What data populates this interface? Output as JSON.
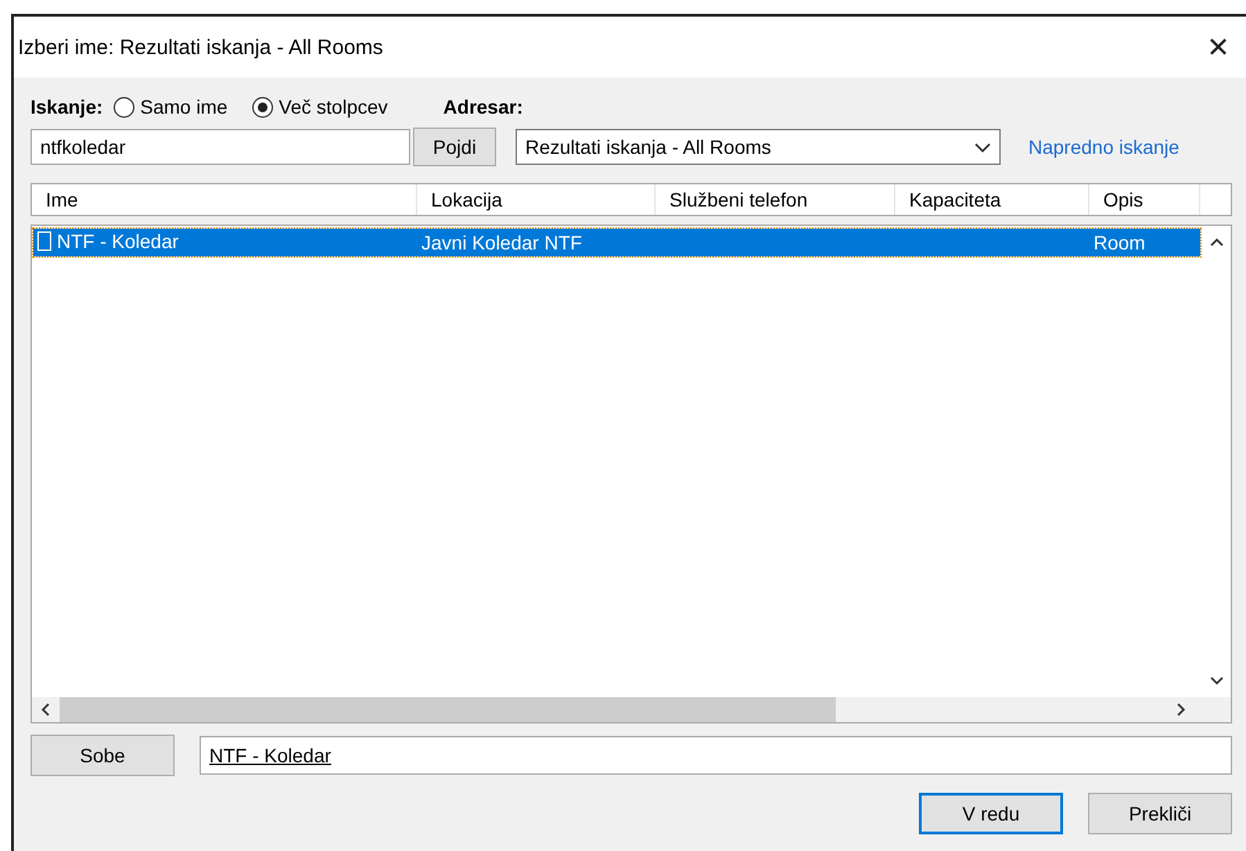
{
  "window": {
    "title": "Izberi ime: Rezultati iskanja - All Rooms",
    "close": "✕"
  },
  "search": {
    "label": "Iskanje:",
    "options": [
      {
        "label": "Samo ime",
        "selected": false
      },
      {
        "label": "Več stolpcev",
        "selected": true
      }
    ],
    "value": "ntfkoledar",
    "go_button": "Pojdi"
  },
  "address_book": {
    "label": "Adresar:",
    "value": "Rezultati iskanja - All Rooms",
    "advanced_link": "Napredno iskanje"
  },
  "table": {
    "columns": [
      "Ime",
      "Lokacija",
      "Službeni telefon",
      "Kapaciteta",
      "Opis"
    ],
    "rows": [
      {
        "cells": [
          "NTF - Koledar",
          "Javni Koledar NTF",
          "",
          "",
          "Room"
        ],
        "selected": true
      }
    ]
  },
  "rooms_button": "Sobe",
  "rooms_value": "NTF - Koledar",
  "buttons": [
    {
      "label": "V redu",
      "default": true
    },
    {
      "label": "Prekliči",
      "default": false
    }
  ]
}
